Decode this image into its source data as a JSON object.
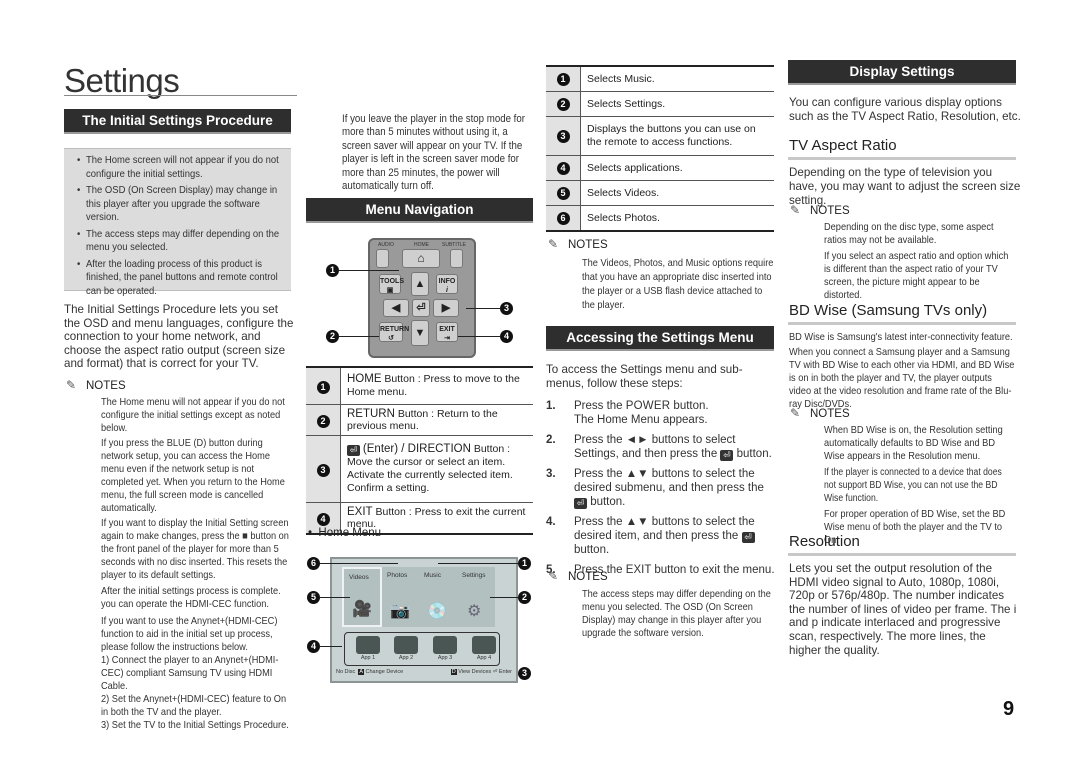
{
  "page": {
    "title": "Settings",
    "page_number": "9"
  },
  "col1": {
    "section_title": "The Initial Settings Procedure",
    "bullets": [
      "The Home screen will not appear if you do not configure the initial settings.",
      "The OSD (On Screen Display) may change in this player after you upgrade the software version.",
      "The access steps may differ depending on the menu you selected.",
      "After the loading process of this product is finished, the panel buttons and remote control can be operated."
    ],
    "intro": "The Initial Settings Procedure lets you set the OSD and menu languages, configure the connection to your home network, and choose the aspect ratio output (screen size and format) that is correct for your TV.",
    "notes_label": "NOTES",
    "notes": [
      "The Home menu will not appear if you do not configure the initial settings except as noted below.",
      "If you press the BLUE (D) button during network setup, you can access the Home menu even if the network setup is not completed yet. When you return to the Home menu, the full screen mode is cancelled automatically.",
      "If you want to display the Initial Setting screen again to make changes, press the ■ button on the front panel of the player for more than 5 seconds with no disc inserted. This resets the player to its default settings.",
      "After the initial settings process is complete. you can operate the HDMI-CEC function.",
      "If you want to use the Anynet+(HDMI-CEC) function to aid in the initial set up process, please follow the instructions below.",
      "1) Connect the player to an Anynet+(HDMI-CEC) compliant Samsung TV using HDMI Cable.",
      "2) Set the Anynet+(HDMI-CEC) feature to On in both the TV and the player.",
      "3) Set the TV to the Initial Settings Procedure."
    ]
  },
  "col2": {
    "screensaver_text": "If you leave the player in the stop mode for more than 5 minutes without using it, a screen saver will appear on your TV. If the player is left in the screen saver mode for more than 25 minutes, the power will automatically turn off.",
    "section_title": "Menu Navigation",
    "remote": {
      "labels": {
        "audio": "AUDIO",
        "home": "HOME",
        "subtitle": "SUBTITLE",
        "tools": "TOOLS",
        "info": "INFO",
        "return": "RETURN",
        "exit": "EXIT"
      },
      "callouts": [
        "1",
        "2",
        "3",
        "4"
      ]
    },
    "nav_table": [
      {
        "num": "1",
        "head": "HOME",
        "text": "Button : Press to move to the Home menu."
      },
      {
        "num": "2",
        "head": "RETURN",
        "text": "Button : Return to the previous menu."
      },
      {
        "num": "3",
        "head": "(Enter) / DIRECTION",
        "text": "Button :",
        "lines": [
          "Move the cursor or select an item.",
          "Activate the currently selected item.",
          "Confirm a setting."
        ]
      },
      {
        "num": "4",
        "head": "EXIT",
        "text": "Button : Press to exit the current menu."
      }
    ],
    "home_menu_label": "Home Menu",
    "home_menu": {
      "tiles": [
        "Videos",
        "Photos",
        "Music",
        "Settings"
      ],
      "apps": [
        "App 1",
        "App 2",
        "App 3",
        "App 4"
      ],
      "footer_left_prefix": "No Disc",
      "footer_left_key": "A",
      "footer_left": "Change Device",
      "footer_right_key": "D",
      "footer_right": "View Devices",
      "footer_enter": "Enter",
      "callouts": [
        "6",
        "1",
        "5",
        "2",
        "4",
        "3"
      ]
    }
  },
  "col3": {
    "home_table": [
      {
        "num": "1",
        "text": "Selects Music."
      },
      {
        "num": "2",
        "text": "Selects Settings."
      },
      {
        "num": "3",
        "text": "Displays the buttons you can use on the remote to access functions."
      },
      {
        "num": "4",
        "text": "Selects applications."
      },
      {
        "num": "5",
        "text": "Selects Videos."
      },
      {
        "num": "6",
        "text": "Selects Photos."
      }
    ],
    "notes_label": "NOTES",
    "notes": "The Videos, Photos, and Music options require that you have an appropriate disc inserted into the player or a USB flash device attached to the player.",
    "section_title": "Accessing the Settings Menu",
    "intro": "To access the Settings menu and sub-menus, follow these steps:",
    "steps": [
      {
        "n": "1.",
        "a": "Press the ",
        "b": "POWER",
        "c": " button.",
        "d": "The Home Menu appears."
      },
      {
        "n": "2.",
        "a": "Press the ◄► buttons to select ",
        "b": "Settings",
        "c": ", and then press the ",
        "d": " button."
      },
      {
        "n": "3.",
        "a": "Press the ▲▼ buttons to select the desired submenu, and then press the ",
        "d": " button."
      },
      {
        "n": "4.",
        "a": "Press the ▲▼ buttons to select the desired item, and then press the ",
        "d": " button."
      },
      {
        "n": "5.",
        "a": "Press the ",
        "b": "EXIT",
        "c": " button to exit the menu."
      }
    ],
    "notes2_label": "NOTES",
    "notes2": "The access steps may differ depending on the menu you selected. The OSD (On Screen Display) may change in this player after you upgrade the software version."
  },
  "col4": {
    "section_title": "Display Settings",
    "intro": "You can configure various display options such as the TV Aspect Ratio, Resolution, etc.",
    "aspect_title": "TV Aspect Ratio",
    "aspect_text": "Depending on the type of television you have, you may want to adjust the screen size setting.",
    "aspect_notes_label": "NOTES",
    "aspect_notes": [
      "Depending on the disc type, some aspect ratios may not be available.",
      "If you select an aspect ratio and option which is different than the aspect ratio of your TV screen, the picture might appear to be distorted."
    ],
    "bdwise_title": "BD Wise (Samsung TVs only)",
    "bdwise_text": [
      "BD Wise is Samsung's latest inter-connectivity feature.",
      "When you connect a Samsung player and a Samsung TV with BD Wise to each other via HDMI, and BD Wise is on in both the player and TV, the player outputs video at the video resolution and frame rate of the Blu-ray Disc/DVDs."
    ],
    "bdwise_notes_label": "NOTES",
    "bdwise_notes": [
      "When BD Wise is on, the Resolution setting automatically defaults to BD Wise and BD Wise appears in the Resolution menu.",
      "If the player is connected to a device that does not support BD Wise, you can not use the BD Wise function.",
      "For proper operation of BD Wise, set the BD Wise menu of both the player and the TV to On"
    ],
    "resolution_title": "Resolution",
    "resolution_text": "Lets you set the output resolution of the HDMI video signal to Auto, 1080p, 1080i, 720p or 576p/480p. The number indicates the number of lines of video per frame. The i and p indicate interlaced and progressive scan, respectively. The more lines, the higher the quality."
  }
}
